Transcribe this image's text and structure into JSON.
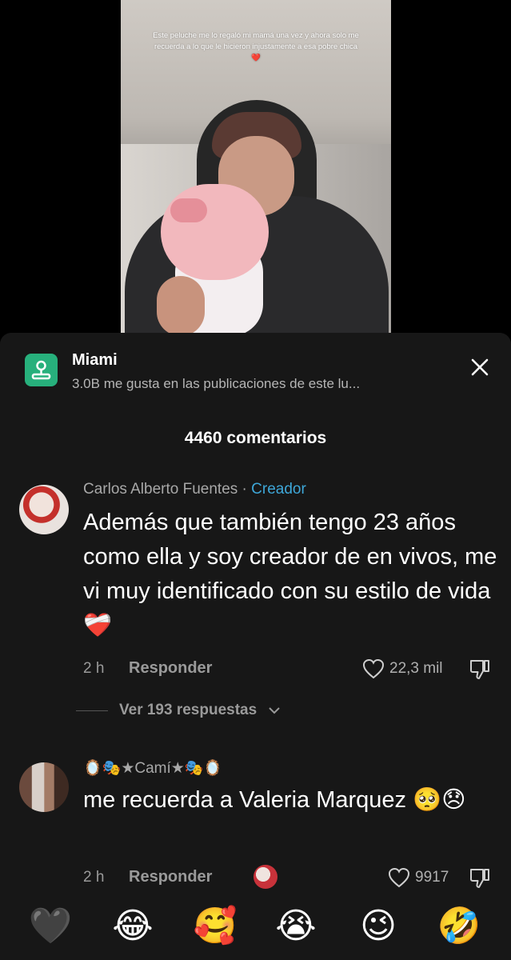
{
  "video": {
    "caption": "Este peluche me lo regaló mi mamá una vez y ahora solo me recuerda a lo que le hicieron injustamente a esa pobre chica ❤️"
  },
  "location": {
    "title": "Miami",
    "subtitle": "3.0B me gusta en las publicaciones de este lu...",
    "icon": "map-pin-icon"
  },
  "comments_header": "4460 comentarios",
  "comments": [
    {
      "username": "Carlos Alberto Fuentes",
      "separator": " · ",
      "badge": "Creador",
      "text": "Además que también tengo 23 años como ella y soy creador de en vivos, me vi muy identificado con su estilo de vida ❤️‍🩹",
      "time": "2 h",
      "reply_label": "Responder",
      "likes": "22,3 mil",
      "view_replies": "Ver 193 respuestas"
    },
    {
      "username": "🪞🎭★Camí★🎭🪞",
      "text": "me recuerda a Valeria Marquez 🥺😞",
      "time": "2 h",
      "reply_label": "Responder",
      "likes": "9917"
    }
  ],
  "emoji_bar": [
    "🖤",
    "😂",
    "🥰",
    "😭",
    "😉",
    "🤣"
  ],
  "colors": {
    "sheet_bg": "#171717",
    "accent_creator": "#3ea7d8",
    "location_icon_bg": "#27b07c"
  }
}
